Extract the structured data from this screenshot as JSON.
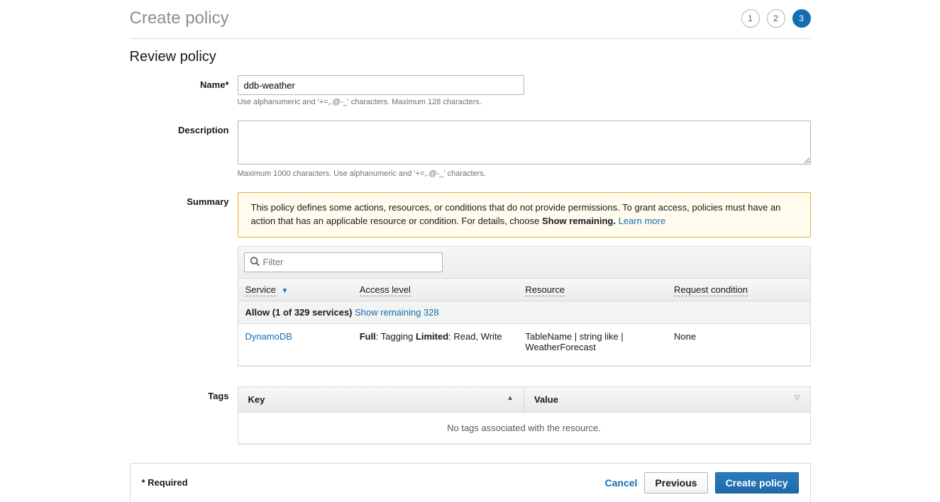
{
  "header": {
    "title": "Create policy",
    "steps": [
      "1",
      "2",
      "3"
    ],
    "active_step_index": 2
  },
  "section_title": "Review policy",
  "name": {
    "label": "Name*",
    "value": "ddb-weather",
    "hint": "Use alphanumeric and '+=,.@-_' characters. Maximum 128 characters."
  },
  "description": {
    "label": "Description",
    "value": "",
    "hint": "Maximum 1000 characters. Use alphanumeric and '+=,.@-_' characters."
  },
  "summary": {
    "label": "Summary",
    "warning_pre": "This policy defines some actions, resources, or conditions that do not provide permissions. To grant access, policies must have an action that has an applicable resource or condition. For details, choose ",
    "warning_bold": "Show remaining.",
    "learn_more": "Learn more",
    "filter_placeholder": "Filter",
    "columns": {
      "service": "Service",
      "access_level": "Access level",
      "resource": "Resource",
      "request_condition": "Request condition"
    },
    "group": {
      "label_bold": "Allow (1 of 329 services)",
      "show_remaining": "Show remaining 328"
    },
    "rows": [
      {
        "service": "DynamoDB",
        "access_full_label": "Full",
        "access_full_value": ": Tagging ",
        "access_limited_label": "Limited",
        "access_limited_value": ": Read, Write",
        "resource": "TableName | string like | WeatherForecast",
        "condition": "None"
      }
    ]
  },
  "tags": {
    "label": "Tags",
    "columns": {
      "key": "Key",
      "value": "Value"
    },
    "empty": "No tags associated with the resource."
  },
  "footer": {
    "required": "* Required",
    "cancel": "Cancel",
    "previous": "Previous",
    "create": "Create policy"
  }
}
